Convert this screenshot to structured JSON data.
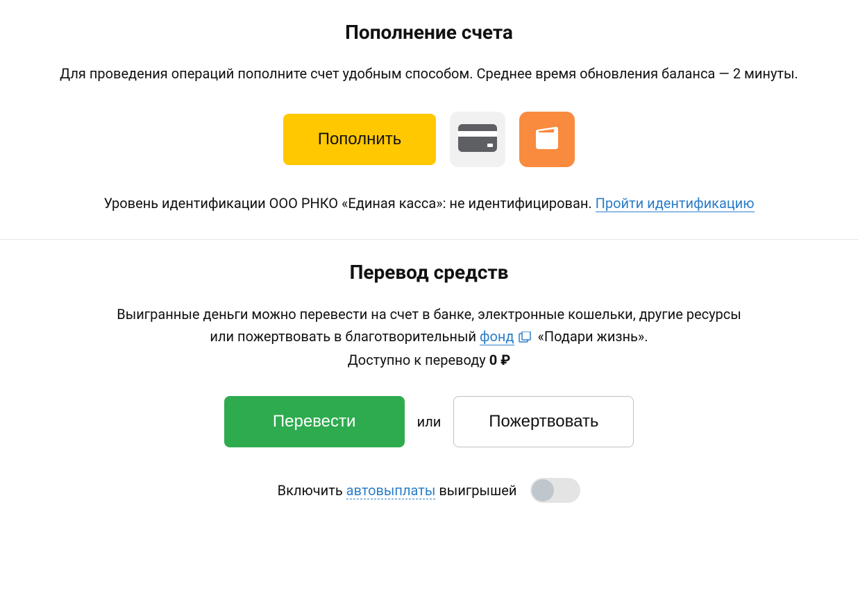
{
  "topup": {
    "title": "Пополнение счета",
    "description": "Для проведения операций пополните счет удобным способом. Среднее время обновления баланса — 2 минуты.",
    "button_label": "Пополнить",
    "identity_text": "Уровень идентификации ООО РНКО «Единая касса»: не идентифицирован. ",
    "identity_link": "Пройти идентификацию"
  },
  "transfer": {
    "title": "Перевод средств",
    "desc_line1": "Выигранные деньги можно перевести на счет в банке, электронные кошельки, другие ресурсы",
    "desc_line2_before": "или пожертвовать в благотворительный ",
    "fund_link": "фонд",
    "desc_line2_after": "«Подари жизнь».",
    "available_label": "Доступно к переводу ",
    "available_value": "0 ₽",
    "transfer_button": "Перевести",
    "or": "или",
    "donate_button": "Пожертвовать",
    "autopay_before": "Включить ",
    "autopay_link": "автовыплаты",
    "autopay_after": " выигрышей"
  }
}
